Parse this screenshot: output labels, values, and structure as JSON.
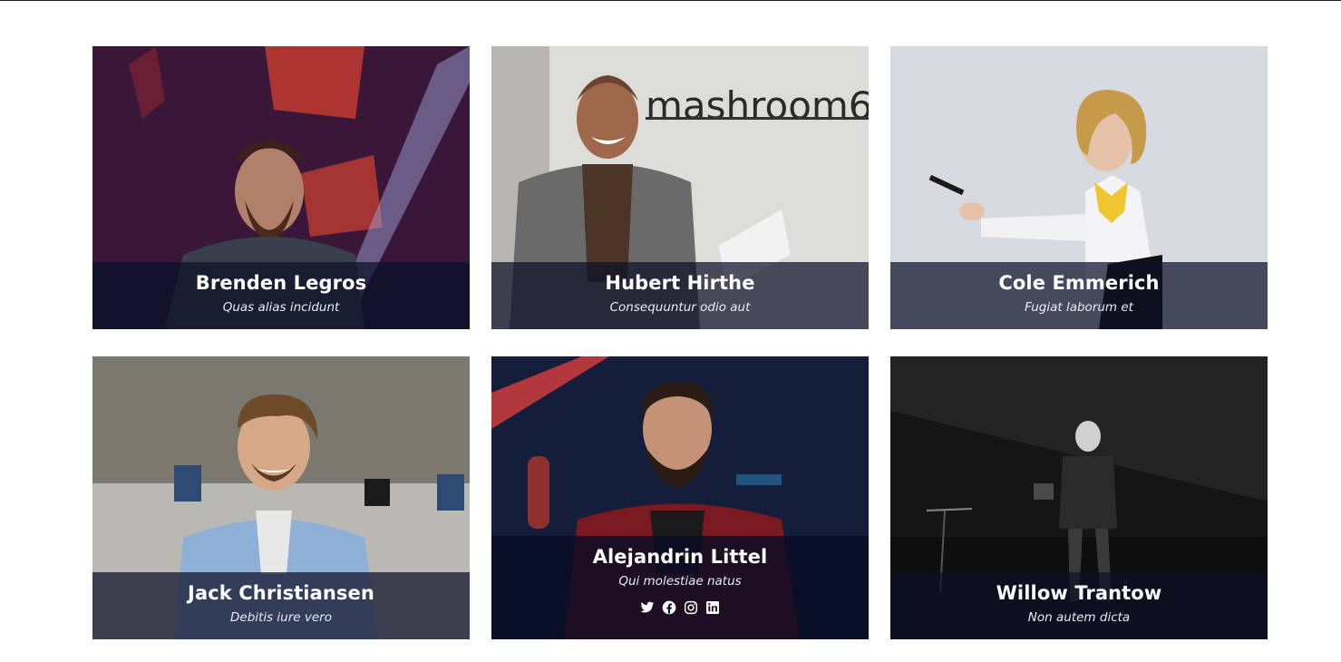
{
  "team": [
    {
      "name": "Brenden Legros",
      "role": "Quas alias incidunt",
      "photo_icon": "speaker-photo"
    },
    {
      "name": "Hubert Hirthe",
      "role": "Consequuntur odio aut",
      "photo_icon": "smiling-man-photo",
      "photo_text": "mashroom6"
    },
    {
      "name": "Cole Emmerich",
      "role": "Fugiat laborum et",
      "photo_icon": "presenter-woman-photo"
    },
    {
      "name": "Jack Christiansen",
      "role": "Debitis iure vero",
      "photo_icon": "office-man-photo"
    },
    {
      "name": "Alejandrin Littel",
      "role": "Qui molestiae natus",
      "photo_icon": "bearded-man-photo",
      "social": [
        "twitter-icon",
        "facebook-icon",
        "instagram-icon",
        "linkedin-icon"
      ]
    },
    {
      "name": "Willow Trantow",
      "role": "Non autem dicta",
      "photo_icon": "stage-speaker-photo"
    }
  ],
  "colors": {
    "caption_overlay": "#0c1028",
    "text": "#ffffff"
  }
}
